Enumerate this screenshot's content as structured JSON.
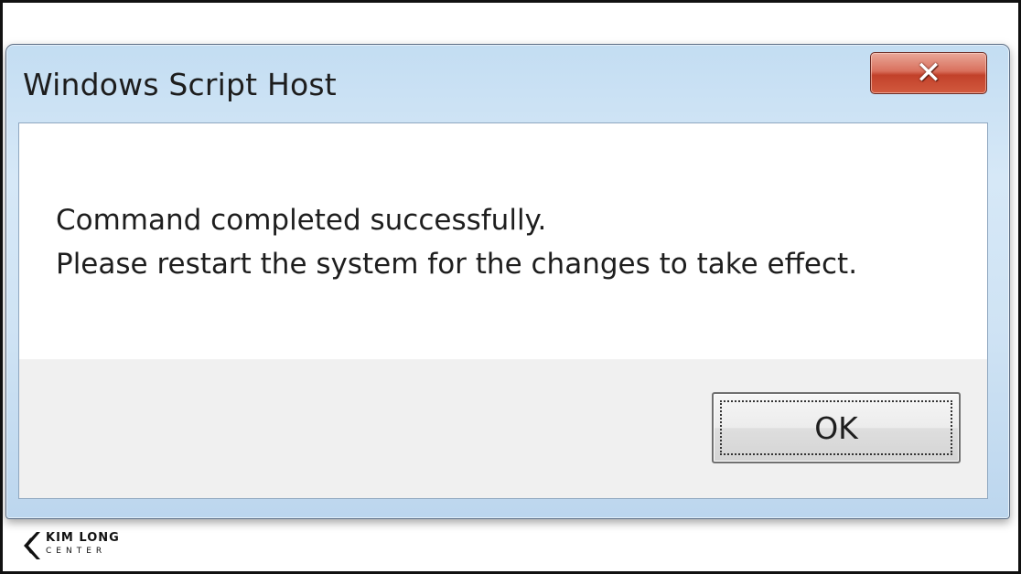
{
  "window": {
    "title": "Windows Script Host",
    "close_icon": "close-x-icon"
  },
  "message": {
    "line1": "Command completed successfully.",
    "line2": "Please restart the system for the changes to take effect."
  },
  "buttons": {
    "ok_label": "OK"
  },
  "watermark": {
    "title": "KIM LONG",
    "subtitle": "CENTER",
    "icon": "kim-long-logo-icon"
  },
  "colors": {
    "close_button": "#c2412a",
    "title_bar": "#c3ddf2",
    "content_background": "#ffffff",
    "footer_background": "#f0f0f0"
  }
}
